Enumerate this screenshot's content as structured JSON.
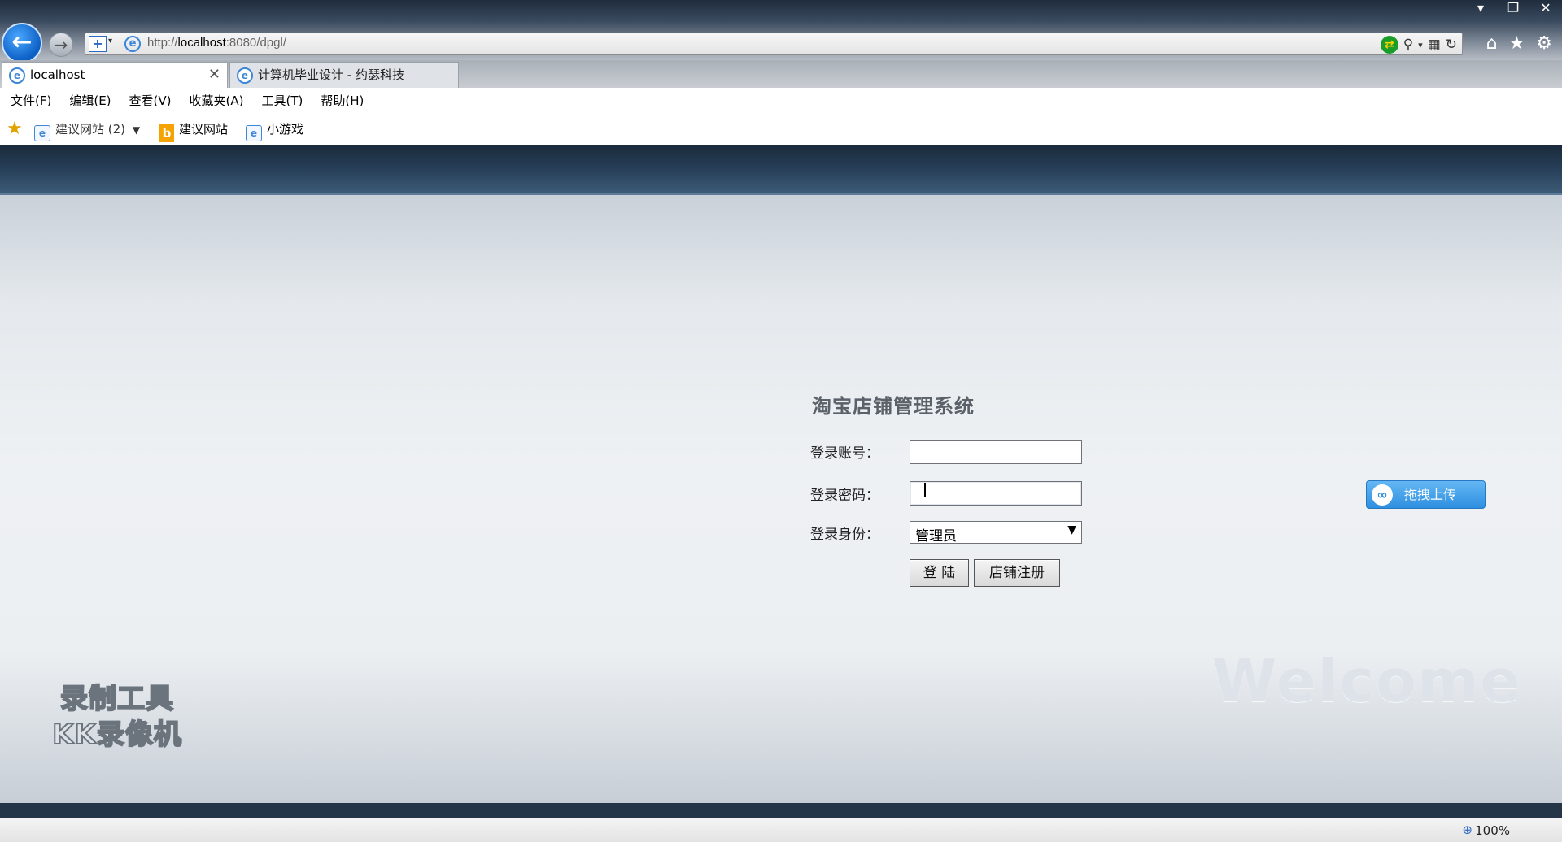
{
  "browser": {
    "window_controls": [
      "▾",
      "❐",
      "✕"
    ],
    "url_prefix": "http://",
    "url_host": "localhost",
    "url_rest": ":8080/dpgl/",
    "tabs": [
      {
        "label": "localhost",
        "close": "✕"
      },
      {
        "label": "计算机毕业设计 - 约瑟科技"
      }
    ],
    "menu": [
      "文件(F)",
      "编辑(E)",
      "查看(V)",
      "收藏夹(A)",
      "工具(T)",
      "帮助(H)"
    ],
    "favorites": [
      {
        "label": "建议网站 (2)",
        "icon": "ie-page-icon"
      },
      {
        "label": "建议网站",
        "icon": "bing-icon"
      },
      {
        "label": "小游戏",
        "icon": "ie-page-icon"
      }
    ],
    "zoom": "100%"
  },
  "login": {
    "title": "淘宝店铺管理系统",
    "account_label": "登录账号：",
    "password_label": "登录密码：",
    "role_label": "登录身份：",
    "role_value": "管理员",
    "login_button": "登 陆",
    "register_button": "店铺注册"
  },
  "overlays": {
    "upload_label": "拖拽上传",
    "welcome": "Welcome",
    "recorder_line1": "录制工具",
    "recorder_line2": "KK录像机"
  }
}
